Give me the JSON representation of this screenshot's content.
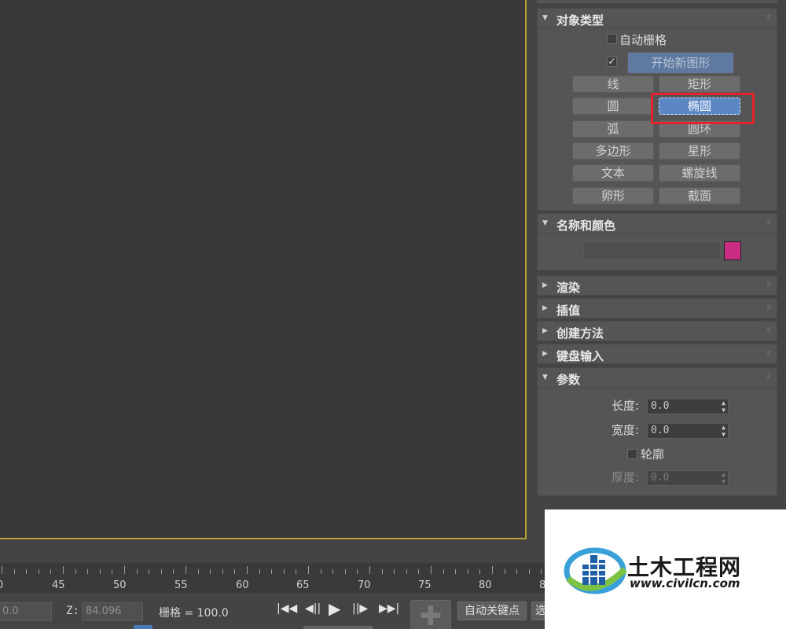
{
  "command_panel": {
    "object_type": {
      "title": "对象类型",
      "auto_grid_label": "自动栅格",
      "start_new_shape_label": "开始新图形",
      "start_new_shape_checked": true,
      "buttons": {
        "line": "线",
        "rectangle": "矩形",
        "circle": "圆",
        "ellipse": "椭圆",
        "arc": "弧",
        "donut": "圆环",
        "ngon": "多边形",
        "star": "星形",
        "text": "文本",
        "helix": "螺旋线",
        "egg": "卵形",
        "section": "截面"
      }
    },
    "name_and_color": {
      "title": "名称和颜色",
      "name_value": "",
      "color": "#cc2d84"
    },
    "rendering": {
      "title": "渲染"
    },
    "interpolation": {
      "title": "插值"
    },
    "creation_method": {
      "title": "创建方法"
    },
    "keyboard_entry": {
      "title": "键盘输入"
    },
    "parameters": {
      "title": "参数",
      "length_label": "长度:",
      "length_value": "0.0",
      "width_label": "宽度:",
      "width_value": "0.0",
      "outline_label": "轮廓",
      "thickness_label": "厚度:",
      "thickness_value": "0.0"
    }
  },
  "timeline": {
    "tick_labels": [
      "0",
      "45",
      "50",
      "55",
      "60",
      "65",
      "70",
      "75",
      "80",
      "8"
    ]
  },
  "statusbar": {
    "x_value": "0.0",
    "z_label": "Z:",
    "z_value": "84.096",
    "grid_label": "栅格 = 100.0",
    "autokey_label": "自动关键点",
    "cut_label": "选"
  },
  "watermark": {
    "brand": "土木工程网",
    "url": "www.civilcn.com"
  },
  "colors": {
    "viewport_border": "#b8a136",
    "active_button": "#5b87c4",
    "highlight_box": "#e3242b"
  }
}
